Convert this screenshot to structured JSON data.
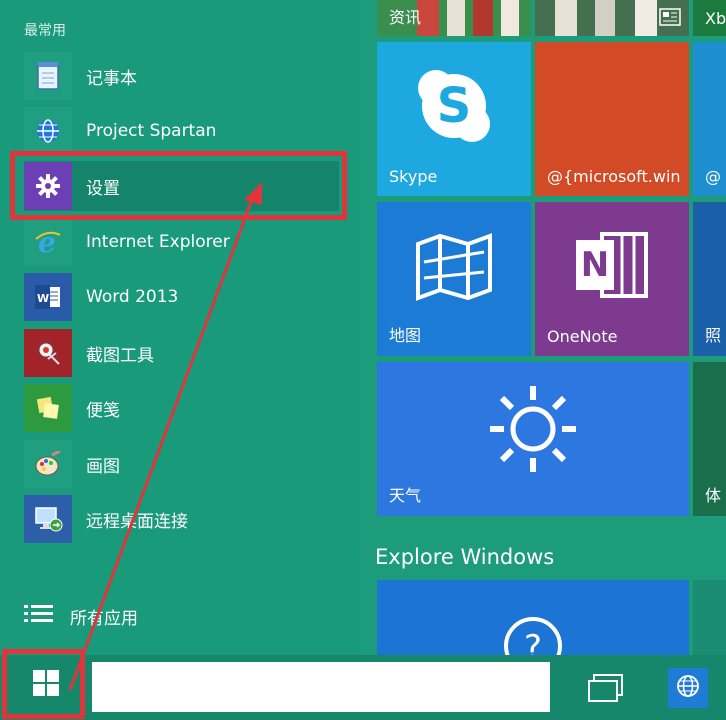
{
  "start_menu": {
    "most_used_label": "最常用",
    "items": [
      {
        "label": "记事本",
        "icon": "notepad-icon"
      },
      {
        "label": "Project Spartan",
        "icon": "globe-icon"
      },
      {
        "label": "设置",
        "icon": "gear-icon"
      },
      {
        "label": "Internet Explorer",
        "icon": "internet-explorer-icon"
      },
      {
        "label": "Word 2013",
        "icon": "word-icon"
      },
      {
        "label": "截图工具",
        "icon": "snipping-tool-icon"
      },
      {
        "label": "便笺",
        "icon": "sticky-notes-icon"
      },
      {
        "label": "画图",
        "icon": "paint-icon"
      },
      {
        "label": "远程桌面连接",
        "icon": "remote-desktop-icon"
      }
    ],
    "all_apps_label": "所有应用"
  },
  "tiles": {
    "news_label": "资讯",
    "xbox_partial": "Xb",
    "skype_label": "Skype",
    "ms_label": "@{microsoft.win",
    "ms_partial": "@",
    "maps_label": "地图",
    "onenote_label": "OneNote",
    "photos_partial": "照",
    "weather_label": "天气",
    "sports_partial": "体",
    "explore_heading": "Explore Windows"
  },
  "taskbar": {
    "search_value": ""
  },
  "colors": {
    "background": "#1d9c7c",
    "highlight": "#e0353a",
    "skype_tile": "#1ea8e0",
    "orange_tile": "#d24a26",
    "maps_tile": "#1c7cd5",
    "onenote_tile": "#7d3a8e",
    "weather_tile": "#2d77e0"
  }
}
